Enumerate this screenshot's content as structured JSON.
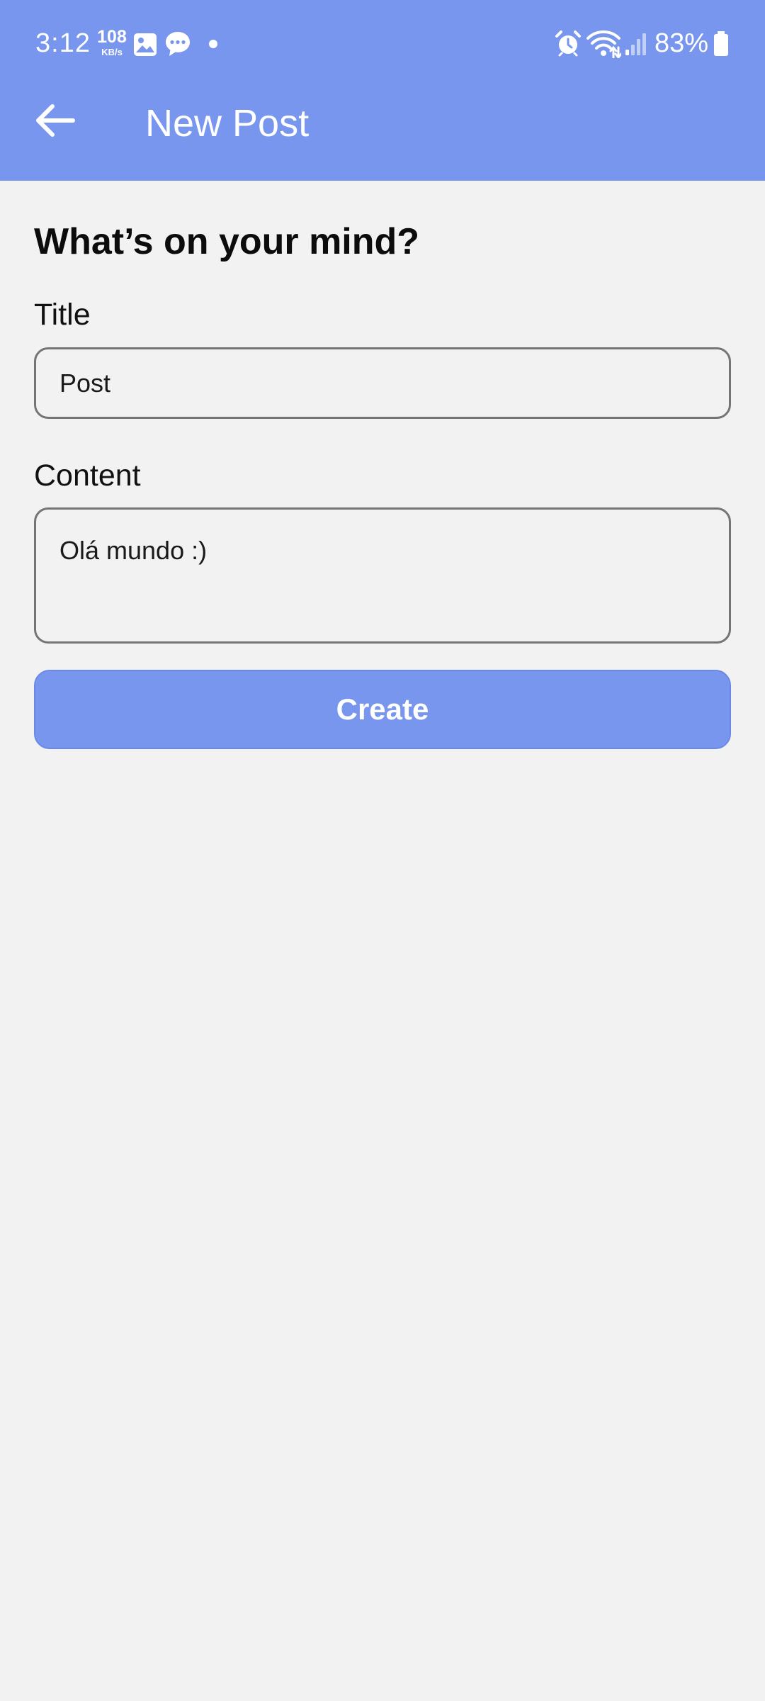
{
  "status_bar": {
    "time": "3:12",
    "network_speed_value": "108",
    "network_speed_unit": "KB/s",
    "battery_percent": "83%",
    "notification_icons": [
      "gallery-icon",
      "chat-bubble-icon",
      "dot-icon"
    ],
    "system_icons": [
      "alarm-icon",
      "wifi-icon",
      "signal-icon",
      "battery-icon"
    ]
  },
  "app_bar": {
    "back_icon": "arrow-left-icon",
    "title": "New Post"
  },
  "form": {
    "heading": "What’s on your mind?",
    "title_label": "Title",
    "title_value": "Post",
    "content_label": "Content",
    "content_value": "Olá mundo :)",
    "submit_label": "Create"
  },
  "colors": {
    "accent": "#7896ee",
    "background": "#f2f2f2",
    "input_border": "#757575"
  }
}
